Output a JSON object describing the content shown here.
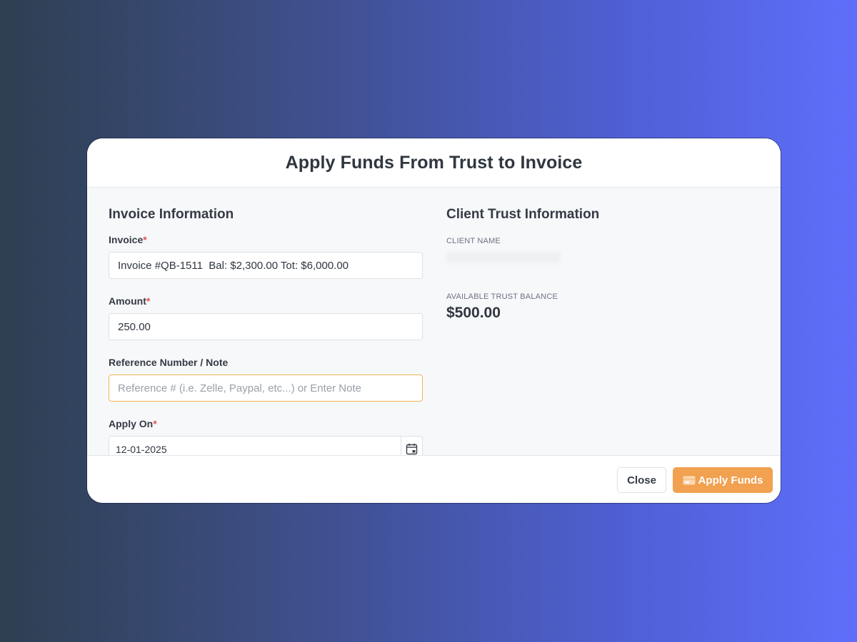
{
  "modal": {
    "title": "Apply Funds From Trust to Invoice"
  },
  "invoice_section": {
    "title": "Invoice Information",
    "invoice_label": "Invoice",
    "invoice_value": "Invoice #QB-1511  Bal: $2,300.00 Tot: $6,000.00",
    "amount_label": "Amount",
    "amount_value": "250.00",
    "reference_label": "Reference Number / Note",
    "reference_placeholder": "Reference # (i.e. Zelle, Paypal, etc...) or Enter Note",
    "reference_value": "",
    "apply_on_label": "Apply On",
    "apply_on_value": "12-01-2025",
    "required_marker": "*"
  },
  "trust_section": {
    "title": "Client Trust Information",
    "client_name_label": "CLIENT NAME",
    "balance_label": "AVAILABLE TRUST BALANCE",
    "balance_value": "$500.00"
  },
  "footer": {
    "close_label": "Close",
    "apply_label": "Apply Funds"
  },
  "colors": {
    "accent": "#f1a150",
    "required": "#e05555",
    "focus_border": "#f0b45a"
  },
  "icons": {
    "date_picker": "calendar-icon",
    "apply_button": "credit-card-icon"
  }
}
